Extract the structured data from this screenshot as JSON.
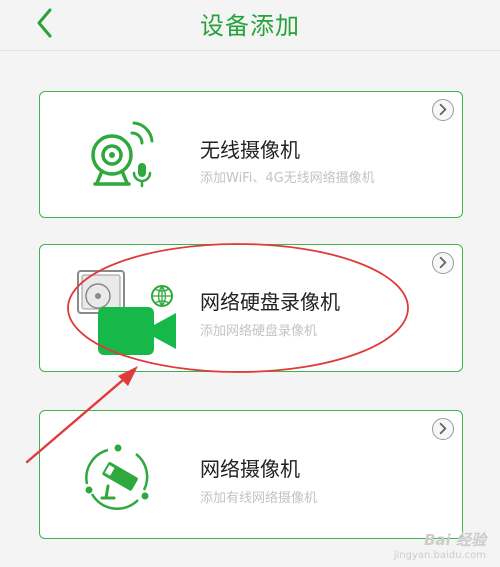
{
  "header": {
    "title": "设备添加",
    "back_icon": "chevron-left-icon"
  },
  "cards": [
    {
      "name": "无线摄像机",
      "desc": "添加WiFi、4G无线网络摄像机",
      "icon": "wireless-camera-icon"
    },
    {
      "name": "网络硬盘录像机",
      "desc": "添加网络硬盘录像机",
      "icon": "nvr-recorder-icon"
    },
    {
      "name": "网络摄像机",
      "desc": "添加有线网络摄像机",
      "icon": "network-camera-icon"
    }
  ],
  "watermark": {
    "logo": "Bai 经验",
    "url": "jingyan.baidu.com"
  },
  "colors": {
    "accent": "#26a33a",
    "border": "#3db54a",
    "annotation": "#e03b3b"
  }
}
